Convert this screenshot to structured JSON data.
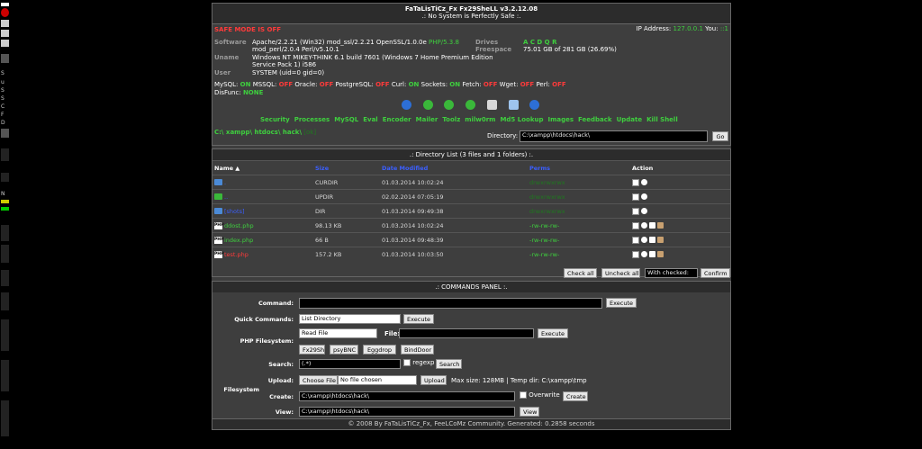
{
  "left_strip_text": [
    "S",
    "u",
    "S",
    "S",
    "C",
    "F",
    "D",
    "N"
  ],
  "header": {
    "title": "FaTaLisTiCz_Fx Fx29SheLL v3.2.12.08",
    "subtitle": ".: No System is Perfectly Safe :.",
    "safe_mode": "SAFE MODE IS OFF",
    "ip_label": "IP Address:",
    "ip_value": "127.0.0.1",
    "you_label": "You:",
    "you_value": "::1"
  },
  "sysinfo": {
    "software_label": "Software",
    "software_value": "Apache/2.2.21 (Win32) mod_ssl/2.2.21 OpenSSL/1.0.0e",
    "php_label": "PHP/5.3.8",
    "software_value2": "mod_perl/2.0.4 Perl/v5.10.1",
    "uname_label": "Uname",
    "uname_value": "Windows NT MIKEY-THINK 6.1 build 7601 (Windows 7 Home Premium Edition",
    "uname_value2": "Service Pack 1) i586",
    "user_label": "User",
    "user_value": "SYSTEM (uid=0 gid=0)",
    "drives_label": "Drives",
    "drives_value": "A C D Q R",
    "freespace_label": "Freespace",
    "freespace_value": "75.01 GB of 281 GB (26.69%)"
  },
  "features": [
    {
      "name": "MySQL:",
      "state": "ON"
    },
    {
      "name": "MSSQL:",
      "state": "OFF"
    },
    {
      "name": "Oracle:",
      "state": "OFF"
    },
    {
      "name": "PostgreSQL:",
      "state": "OFF"
    },
    {
      "name": "Curl:",
      "state": "ON"
    },
    {
      "name": "Sockets:",
      "state": "ON"
    },
    {
      "name": "Fetch:",
      "state": "OFF"
    },
    {
      "name": "Wget:",
      "state": "OFF"
    },
    {
      "name": "Perl:",
      "state": "OFF"
    }
  ],
  "disfunc_label": "DisFunc:",
  "disfunc_value": "NONE",
  "toolbar_icons": [
    "home-icon",
    "back-icon",
    "forward-icon",
    "up-icon",
    "search-icon",
    "buffer-icon",
    "help-icon"
  ],
  "menu": [
    "Security",
    "Processes",
    "MySQL",
    "Eval",
    "Encoder",
    "Mailer",
    "Toolz",
    "milw0rm",
    "Md5 Lookup",
    "Images",
    "Feedback",
    "Update",
    "Kill Shell"
  ],
  "path": {
    "crumb": "C:\\ xampp\\ htdocs\\ hack\\",
    "status": "[ok]",
    "directory_label": "Directory:",
    "directory_value": "C:\\xampp\\htdocs\\hack\\",
    "go_label": "Go"
  },
  "dirlist": {
    "title": ".: Directory List (3 files and 1 folders) :.",
    "headers": {
      "name": "Name",
      "size": "Size",
      "date": "Date Modified",
      "perms": "Perms",
      "action": "Action"
    },
    "rows": [
      {
        "name": ".",
        "size": "CURDIR",
        "date": "01.03.2014 10:02:24",
        "perms": "drwxrwxrwx",
        "kind": "folder"
      },
      {
        "name": "..",
        "size": "UPDIR",
        "date": "02.02.2014 07:05:19",
        "perms": "drwxrwxrwx",
        "kind": "up"
      },
      {
        "name": "[shots]",
        "size": "DIR",
        "date": "01.03.2014 09:49:38",
        "perms": "drwxrwxrwx",
        "kind": "folder"
      },
      {
        "name": "ddost.php",
        "size": "98.13 KB",
        "date": "01.03.2014 10:02:24",
        "perms": "-rw-rw-rw-",
        "kind": "php"
      },
      {
        "name": "index.php",
        "size": "66 B",
        "date": "01.03.2014 09:48:39",
        "perms": "-rw-rw-rw-",
        "kind": "php"
      },
      {
        "name": "test.php",
        "size": "157.2 KB",
        "date": "01.03.2014 10:03:50",
        "perms": "-rw-rw-rw-",
        "kind": "php"
      }
    ],
    "check_all": "Check all",
    "uncheck_all": "Uncheck all",
    "with_checked": "With checked:",
    "confirm": "Confirm"
  },
  "commands": {
    "title": ".: COMMANDS PANEL :.",
    "command_label": "Command:",
    "command_value": "",
    "execute": "Execute",
    "quick_label": "Quick Commands:",
    "quick_value": "List Directory",
    "php_fs_label": "PHP Filesystem:",
    "read_file_value": "Read File",
    "file_label": "File:",
    "file_value": "",
    "tools": [
      "Fx29Sh",
      "psyBNC",
      "Eggdrop",
      "BindDoor"
    ],
    "search_label": "Search:",
    "search_value": "(.*)",
    "regexp_label": "regexp",
    "search_button": "Search",
    "filesystem_label": "Filesystem",
    "upload_label": "Upload:",
    "choose_file": "Choose File",
    "no_file": "No file chosen",
    "upload_button": "Upload",
    "upload_info": "Max size: 128MB | Temp dir: C:\\xampp\\tmp",
    "create_label": "Create:",
    "create_value": "C:\\xampp\\htdocs\\hack\\",
    "overwrite_label": "Overwrite",
    "create_button": "Create",
    "view_label": "View:",
    "view_value": "C:\\xampp\\htdocs\\hack\\",
    "view_button": "View"
  },
  "footer": "© 2008 By FaTaLisTiCz_Fx, FeeLCoMz Community. Generated: 0.2858 seconds",
  "colors": {
    "background": "#000000",
    "panel": "#3e3e3e",
    "accent_green": "#3ecf3e",
    "accent_red": "#ff3a3a",
    "accent_blue": "#3b5fff"
  }
}
